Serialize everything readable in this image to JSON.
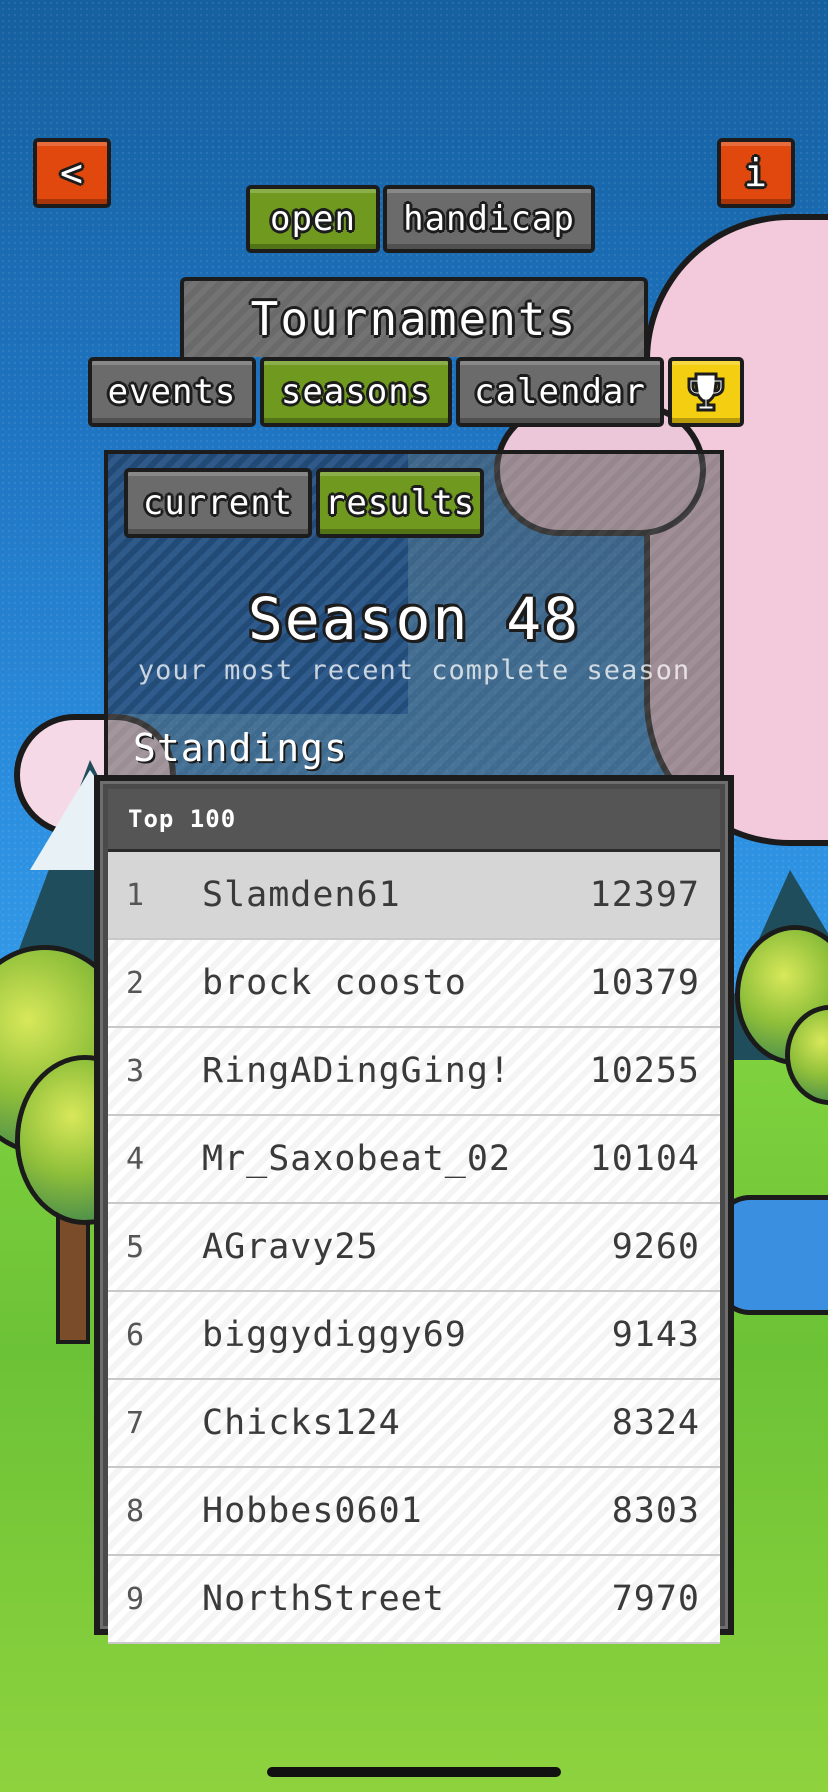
{
  "top_bar": {
    "back_label": "<",
    "info_label": "i"
  },
  "mode_tabs": [
    {
      "label": "open",
      "active": true
    },
    {
      "label": "handicap",
      "active": false
    }
  ],
  "title": "Tournaments",
  "section_tabs": [
    {
      "label": "events",
      "active": false
    },
    {
      "label": "seasons",
      "active": true
    },
    {
      "label": "calendar",
      "active": false
    }
  ],
  "trophy_icon": "trophy-icon",
  "sub_tabs": [
    {
      "label": "current",
      "active": false
    },
    {
      "label": "results",
      "active": true
    }
  ],
  "season": {
    "title": "Season 48",
    "subtitle": "your most recent complete season",
    "standings_label": "Standings"
  },
  "leaderboard": {
    "header": "Top 100",
    "rows": [
      {
        "rank": "1",
        "name": "Slamden61",
        "score": "12397"
      },
      {
        "rank": "2",
        "name": "brock coosto",
        "score": "10379"
      },
      {
        "rank": "3",
        "name": "RingADingGing!",
        "score": "10255"
      },
      {
        "rank": "4",
        "name": "Mr_Saxobeat_02",
        "score": "10104"
      },
      {
        "rank": "5",
        "name": "AGravy25",
        "score": "9260"
      },
      {
        "rank": "6",
        "name": "biggydiggy69",
        "score": "9143"
      },
      {
        "rank": "7",
        "name": "Chicks124",
        "score": "8324"
      },
      {
        "rank": "8",
        "name": "Hobbes0601",
        "score": "8303"
      },
      {
        "rank": "9",
        "name": "NorthStreet",
        "score": "7970"
      }
    ]
  },
  "colors": {
    "accent_green": "#6f9a1f",
    "button_gray": "#6b6b6b",
    "button_orange": "#e0480e",
    "trophy_yellow": "#f4cf11",
    "sky_blue": "#1e73bf"
  }
}
